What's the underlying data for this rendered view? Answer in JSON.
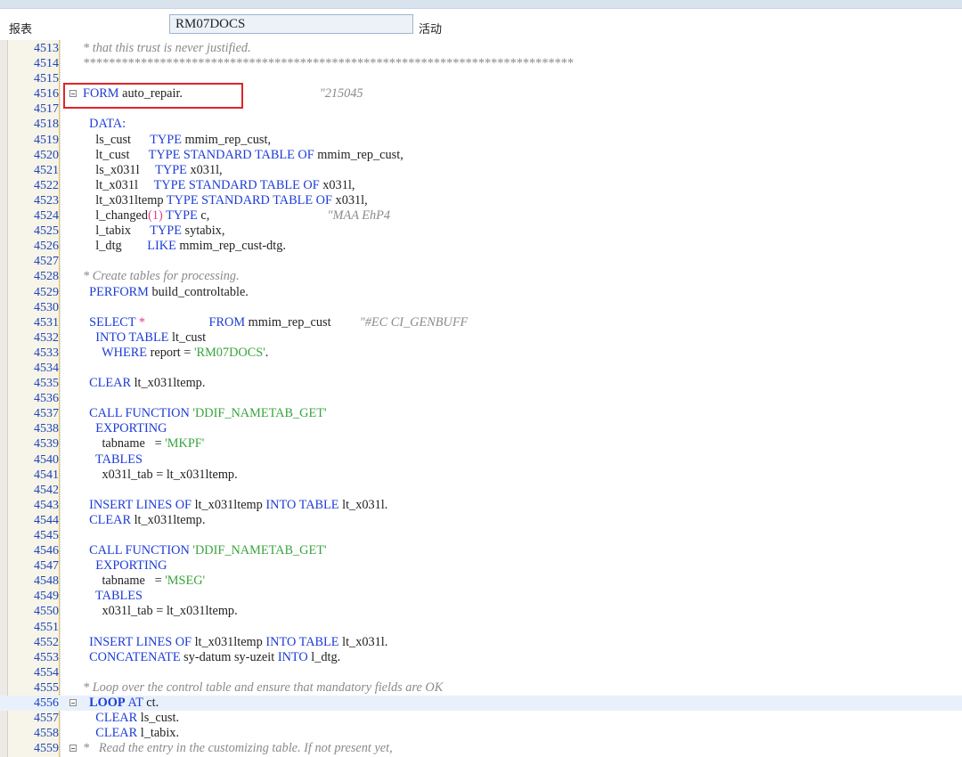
{
  "header": {
    "report_label": "报表",
    "program_name": "RM07DOCS",
    "status": "活动"
  },
  "colors": {
    "keyword": "#1c3cd6",
    "string": "#38a43c",
    "number": "#e0408c",
    "comment": "#8a8a8a",
    "line_number": "#1c44b8",
    "highlight_box": "#e0242a"
  },
  "editor": {
    "lines": [
      {
        "num": "4513",
        "segs": [
          {
            "t": "* that this trust is never justified.",
            "c": "cmt"
          }
        ]
      },
      {
        "num": "4514",
        "segs": [
          {
            "t": "*****************************************************************************",
            "c": "cmt"
          }
        ]
      },
      {
        "num": "4515",
        "segs": []
      },
      {
        "num": "4516",
        "fold": true,
        "segs": [
          {
            "t": "FORM",
            "c": "kw"
          },
          {
            "t": " auto_repair.",
            "c": "id"
          },
          {
            "t": "                                           \"215045",
            "c": "cmt"
          }
        ]
      },
      {
        "num": "4517",
        "segs": []
      },
      {
        "num": "4518",
        "segs": [
          {
            "t": "  DATA:",
            "c": "kw"
          }
        ]
      },
      {
        "num": "4519",
        "segs": [
          {
            "t": "    ls_cust      ",
            "c": "id"
          },
          {
            "t": "TYPE",
            "c": "kw"
          },
          {
            "t": " mmim_rep_cust,",
            "c": "id"
          }
        ]
      },
      {
        "num": "4520",
        "segs": [
          {
            "t": "    lt_cust      ",
            "c": "id"
          },
          {
            "t": "TYPE STANDARD TABLE OF",
            "c": "kw"
          },
          {
            "t": " mmim_rep_cust,",
            "c": "id"
          }
        ]
      },
      {
        "num": "4521",
        "segs": [
          {
            "t": "    ls_x031l     ",
            "c": "id"
          },
          {
            "t": "TYPE",
            "c": "kw"
          },
          {
            "t": " x031l,",
            "c": "id"
          }
        ]
      },
      {
        "num": "4522",
        "segs": [
          {
            "t": "    lt_x031l     ",
            "c": "id"
          },
          {
            "t": "TYPE STANDARD TABLE OF",
            "c": "kw"
          },
          {
            "t": " x031l,",
            "c": "id"
          }
        ]
      },
      {
        "num": "4523",
        "segs": [
          {
            "t": "    lt_x031ltemp ",
            "c": "id"
          },
          {
            "t": "TYPE STANDARD TABLE OF",
            "c": "kw"
          },
          {
            "t": " x031l,",
            "c": "id"
          }
        ]
      },
      {
        "num": "4524",
        "segs": [
          {
            "t": "    l_changed",
            "c": "id"
          },
          {
            "t": "(1)",
            "c": "num"
          },
          {
            "t": " ",
            "c": "id"
          },
          {
            "t": "TYPE",
            "c": "kw"
          },
          {
            "t": " c,",
            "c": "id"
          },
          {
            "t": "                                     \"MAA EhP4",
            "c": "cmt"
          }
        ]
      },
      {
        "num": "4525",
        "segs": [
          {
            "t": "    l_tabix      ",
            "c": "id"
          },
          {
            "t": "TYPE",
            "c": "kw"
          },
          {
            "t": " sytabix,",
            "c": "id"
          }
        ]
      },
      {
        "num": "4526",
        "segs": [
          {
            "t": "    l_dtg        ",
            "c": "id"
          },
          {
            "t": "LIKE",
            "c": "kw"
          },
          {
            "t": " mmim_rep_cust-dtg.",
            "c": "id"
          }
        ]
      },
      {
        "num": "4527",
        "segs": []
      },
      {
        "num": "4528",
        "segs": [
          {
            "t": "* Create tables for processing.",
            "c": "cmt"
          }
        ]
      },
      {
        "num": "4529",
        "segs": [
          {
            "t": "  PERFORM",
            "c": "kw"
          },
          {
            "t": " build_controltable.",
            "c": "id"
          }
        ]
      },
      {
        "num": "4530",
        "segs": []
      },
      {
        "num": "4531",
        "segs": [
          {
            "t": "  SELECT",
            "c": "kw"
          },
          {
            "t": " *",
            "c": "num"
          },
          {
            "t": "                    ",
            "c": "id"
          },
          {
            "t": "FROM",
            "c": "kw"
          },
          {
            "t": " mmim_rep_cust",
            "c": "id"
          },
          {
            "t": "         \"#EC CI_GENBUFF",
            "c": "cmt"
          }
        ]
      },
      {
        "num": "4532",
        "segs": [
          {
            "t": "    INTO TABLE",
            "c": "kw"
          },
          {
            "t": " lt_cust",
            "c": "id"
          }
        ]
      },
      {
        "num": "4533",
        "segs": [
          {
            "t": "      WHERE",
            "c": "kw"
          },
          {
            "t": " report = ",
            "c": "id"
          },
          {
            "t": "'RM07DOCS'",
            "c": "str"
          },
          {
            "t": ".",
            "c": "id"
          }
        ]
      },
      {
        "num": "4534",
        "segs": []
      },
      {
        "num": "4535",
        "segs": [
          {
            "t": "  CLEAR",
            "c": "kw"
          },
          {
            "t": " lt_x031ltemp.",
            "c": "id"
          }
        ]
      },
      {
        "num": "4536",
        "segs": []
      },
      {
        "num": "4537",
        "segs": [
          {
            "t": "  CALL FUNCTION",
            "c": "kw"
          },
          {
            "t": " ",
            "c": "id"
          },
          {
            "t": "'DDIF_NAMETAB_GET'",
            "c": "str"
          }
        ]
      },
      {
        "num": "4538",
        "segs": [
          {
            "t": "    EXPORTING",
            "c": "kw"
          }
        ]
      },
      {
        "num": "4539",
        "segs": [
          {
            "t": "      tabname   = ",
            "c": "id"
          },
          {
            "t": "'MKPF'",
            "c": "str"
          }
        ]
      },
      {
        "num": "4540",
        "segs": [
          {
            "t": "    TABLES",
            "c": "kw"
          }
        ]
      },
      {
        "num": "4541",
        "segs": [
          {
            "t": "      x031l_tab = lt_x031ltemp.",
            "c": "id"
          }
        ]
      },
      {
        "num": "4542",
        "segs": []
      },
      {
        "num": "4543",
        "segs": [
          {
            "t": "  INSERT LINES OF",
            "c": "kw"
          },
          {
            "t": " lt_x031ltemp ",
            "c": "id"
          },
          {
            "t": "INTO TABLE",
            "c": "kw"
          },
          {
            "t": " lt_x031l.",
            "c": "id"
          }
        ]
      },
      {
        "num": "4544",
        "segs": [
          {
            "t": "  CLEAR",
            "c": "kw"
          },
          {
            "t": " lt_x031ltemp.",
            "c": "id"
          }
        ]
      },
      {
        "num": "4545",
        "segs": []
      },
      {
        "num": "4546",
        "segs": [
          {
            "t": "  CALL FUNCTION",
            "c": "kw"
          },
          {
            "t": " ",
            "c": "id"
          },
          {
            "t": "'DDIF_NAMETAB_GET'",
            "c": "str"
          }
        ]
      },
      {
        "num": "4547",
        "segs": [
          {
            "t": "    EXPORTING",
            "c": "kw"
          }
        ]
      },
      {
        "num": "4548",
        "segs": [
          {
            "t": "      tabname   = ",
            "c": "id"
          },
          {
            "t": "'MSEG'",
            "c": "str"
          }
        ]
      },
      {
        "num": "4549",
        "segs": [
          {
            "t": "    TABLES",
            "c": "kw"
          }
        ]
      },
      {
        "num": "4550",
        "segs": [
          {
            "t": "      x031l_tab = lt_x031ltemp.",
            "c": "id"
          }
        ]
      },
      {
        "num": "4551",
        "segs": []
      },
      {
        "num": "4552",
        "segs": [
          {
            "t": "  INSERT LINES OF",
            "c": "kw"
          },
          {
            "t": " lt_x031ltemp ",
            "c": "id"
          },
          {
            "t": "INTO TABLE",
            "c": "kw"
          },
          {
            "t": " lt_x031l.",
            "c": "id"
          }
        ]
      },
      {
        "num": "4553",
        "segs": [
          {
            "t": "  CONCATENATE",
            "c": "kw"
          },
          {
            "t": " sy-datum sy-uzeit ",
            "c": "id"
          },
          {
            "t": "INTO",
            "c": "kw"
          },
          {
            "t": " l_dtg.",
            "c": "id"
          }
        ]
      },
      {
        "num": "4554",
        "segs": []
      },
      {
        "num": "4555",
        "segs": [
          {
            "t": "* Loop over the control table and ensure that mandatory fields are OK",
            "c": "cmt"
          }
        ]
      },
      {
        "num": "4556",
        "fold": true,
        "current": true,
        "segs": [
          {
            "t": "  LOOP",
            "c": "kwb"
          },
          {
            "t": " AT",
            "c": "kw"
          },
          {
            "t": " ct.",
            "c": "id"
          }
        ]
      },
      {
        "num": "4557",
        "segs": [
          {
            "t": "    CLEAR",
            "c": "kw"
          },
          {
            "t": " ls_cust.",
            "c": "id"
          }
        ]
      },
      {
        "num": "4558",
        "segs": [
          {
            "t": "    CLEAR",
            "c": "kw"
          },
          {
            "t": " l_tabix.",
            "c": "id"
          }
        ]
      },
      {
        "num": "4559",
        "fold": true,
        "segs": [
          {
            "t": "*   Read the entry in the customizing table. If not present yet,",
            "c": "cmt"
          }
        ]
      }
    ]
  }
}
